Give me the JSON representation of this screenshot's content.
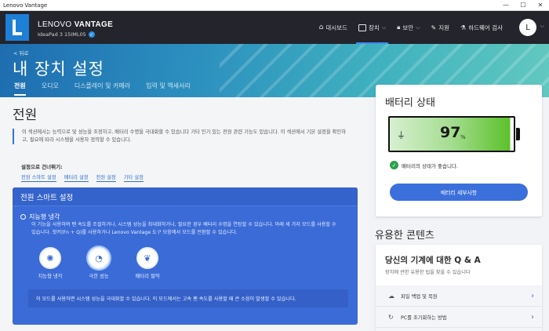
{
  "window": {
    "title": "Lenovo Vantage",
    "controls": [
      "—",
      "☐",
      "✕"
    ]
  },
  "header": {
    "brand_prefix": "LENOVO",
    "brand_suffix": "VANTAGE",
    "device": "IdeaPad 3 15IML05",
    "nav": [
      {
        "label": "대시보드",
        "icon": "home-icon"
      },
      {
        "label": "장치",
        "icon": "laptop-icon",
        "active": true
      },
      {
        "label": "보안",
        "icon": "lock-icon"
      },
      {
        "label": "지원",
        "icon": "wrench-icon"
      },
      {
        "label": "하드웨어 검사",
        "icon": "flask-icon"
      }
    ],
    "avatar_letter": "L"
  },
  "hero": {
    "back": "< 뒤로",
    "title": "내 장치 설정",
    "tabs": [
      "전원",
      "오디오",
      "디스플레이 및 카메라",
      "입력 및 액세서리"
    ]
  },
  "power": {
    "title": "전원",
    "intro": "이 섹션에서는 능력으로 및 성능을 조정하고, 배터리 수명을 극대화할 수 있습니다 기타 인기 있는 전원 관련 기능도 있습니다. 이 섹션에서 기본 설정을 확인하고, 필요에 따라 시스템을 사용자 정의할 수 있습니다.",
    "jump_title": "설정으로 건너뛰기:",
    "jumps": [
      "전원 스마트 설정",
      "배터리 설정",
      "전원 설정",
      "기타 설정"
    ],
    "smart": {
      "title": "전원 스마트 설정",
      "ai_title": "지능형 냉각",
      "ai_desc": "이 기능을 사용하여 팬 속도를 조절하거나, 시스템 성능을 최대화하거나, 필요한 경우 배터리 수명을 연장할 수 있습니다. 아래 세 가지 모드를 사용할 수 있습니다. 핫키(Fn + Q)를 사용하거나 Lenovo Vantage 도구 모음에서 모드를 전환할 수 있습니다.",
      "modes": [
        {
          "label": "지능형 냉각",
          "icon": "fan-icon"
        },
        {
          "label": "극한 성능",
          "icon": "speedometer-icon",
          "selected": true
        },
        {
          "label": "배터리 절약",
          "icon": "leaf-icon"
        }
      ],
      "note": "이 모드를 사용하면 시스템 성능을 극대화할 수 있습니다. 이 모드에서는 고속 팬 속도를 사용할 때 큰 소음이 발생할 수 있습니다."
    }
  },
  "battery": {
    "title": "배터리 상태",
    "percent": "97",
    "percent_sign": "%",
    "level": 0.97,
    "status": "배터리의 상태가 좋습니다.",
    "button": "배터리 세부사항",
    "colors": {
      "fill": "#5cc12a",
      "ok": "#2ba24c",
      "button": "#3b6fdc"
    }
  },
  "useful": {
    "title": "유용한 콘텐츠",
    "qa_title": "당신의 기계에 대한 Q & A",
    "qa_sub": "장치에 관한 유용한 팁을 찾을 수 있습니다",
    "items": [
      {
        "label": "파일 백업 및 복원",
        "icon": "cloud-icon"
      },
      {
        "label": "PC를 초기화하는 방법",
        "icon": "refresh-icon"
      }
    ]
  }
}
